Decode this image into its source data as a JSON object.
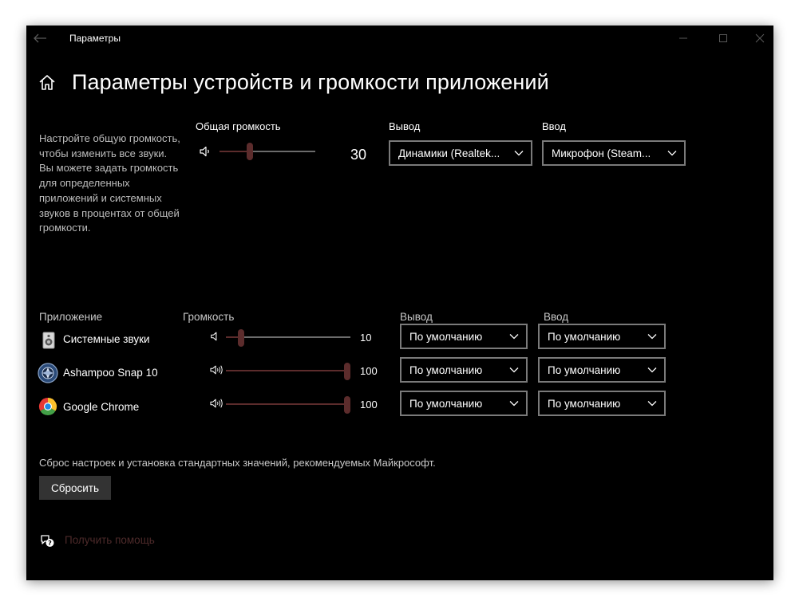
{
  "window": {
    "title": "Параметры",
    "icons": {
      "back": "back-arrow-icon",
      "minimize": "minimize-icon",
      "maximize": "maximize-icon",
      "close": "close-icon"
    }
  },
  "header": {
    "title": "Параметры устройств и громкости приложений",
    "home_icon": "home-icon"
  },
  "colors": {
    "window_bg": "#000000",
    "slider_accent": "#5c2c2c",
    "dropdown_border": "#7a7a7a",
    "help_link": "#4d2a2a"
  },
  "master": {
    "description": "Настройте общую громкость, чтобы изменить все звуки. Вы можете задать громкость для определенных приложений и системных звуков в процентах от общей громкости.",
    "volume_label": "Общая громкость",
    "volume": 30,
    "output_label": "Вывод",
    "output_value": "Динамики (Realtek...",
    "input_label": "Ввод",
    "input_value": "Микрофон (Steam..."
  },
  "apps": {
    "headers": {
      "app": "Приложение",
      "volume": "Громкость",
      "output": "Вывод",
      "input": "Ввод"
    },
    "rows": [
      {
        "name": "Системные звуки",
        "icon": "system-sounds-icon",
        "volume": 10,
        "output": "По умолчанию",
        "input": "По умолчанию"
      },
      {
        "name": "Ashampoo Snap 10",
        "icon": "ashampoo-snap-icon",
        "volume": 100,
        "output": "По умолчанию",
        "input": "По умолчанию"
      },
      {
        "name": "Google Chrome",
        "icon": "chrome-icon",
        "volume": 100,
        "output": "По умолчанию",
        "input": "По умолчанию"
      }
    ]
  },
  "reset": {
    "description": "Сброс настроек и установка стандартных значений, рекомендуемых Майкрософт.",
    "button_label": "Сбросить"
  },
  "help": {
    "label": "Получить помощь",
    "icon": "help-chat-icon"
  }
}
